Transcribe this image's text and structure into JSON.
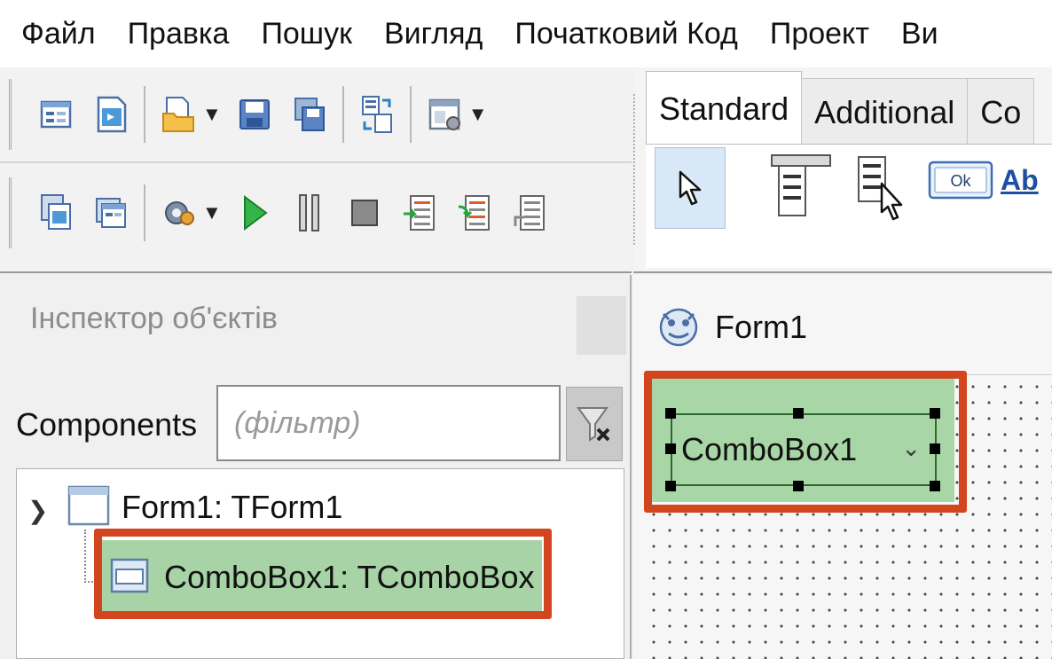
{
  "menu": {
    "items": [
      "Файл",
      "Правка",
      "Пошук",
      "Вигляд",
      "Початковий Код",
      "Проект",
      "Ви"
    ]
  },
  "toolbar": {
    "row1": [
      "new-unit-icon",
      "new-form-icon",
      "open-icon",
      "save-icon",
      "save-all-icon",
      "toggle-form-unit-icon",
      "view-forms-icon"
    ],
    "row2": [
      "view-units-icon",
      "view-form-icon",
      "build-icon",
      "run-icon",
      "pause-icon",
      "stop-icon",
      "step-into-icon",
      "step-over-icon",
      "step-out-icon"
    ]
  },
  "palette": {
    "tabs": [
      "Standard",
      "Additional",
      "Co"
    ],
    "active_tab": "Standard",
    "abc_label": "Ab",
    "ok_label": "Ok"
  },
  "inspector": {
    "title": "Інспектор об'єктів",
    "components_label": "Components",
    "filter_placeholder": "(фільтр)",
    "tree": {
      "form": "Form1: TForm1",
      "combo": "ComboBox1: TComboBox"
    }
  },
  "designer": {
    "form_title": "Form1",
    "combo_text": "ComboBox1"
  },
  "colors": {
    "highlight": "#d2451f",
    "selection_green": "#a8d3a6"
  }
}
